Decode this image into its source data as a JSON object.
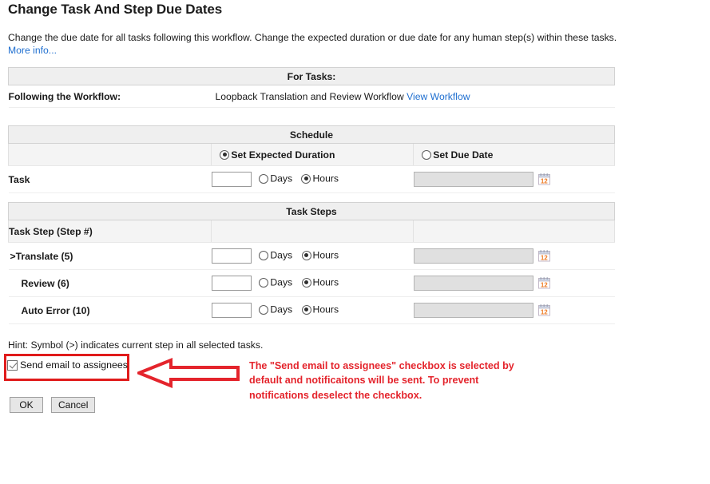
{
  "page": {
    "title": "Change Task And Step Due Dates",
    "description": "Change the due date for all tasks following this workflow. Change the expected duration or due date for any human step(s) within these tasks.",
    "more_info_label": "More info..."
  },
  "for_tasks": {
    "band_label": "For Tasks:",
    "workflow_row_label": "Following the Workflow:",
    "workflow_name": "Loopback Translation and Review Workflow",
    "view_workflow_link": "View Workflow"
  },
  "schedule": {
    "band_label": "Schedule",
    "mode_options": [
      {
        "label": "Set Expected Duration",
        "selected": true
      },
      {
        "label": "Set Due Date",
        "selected": false
      }
    ],
    "task_row": {
      "label": "Task",
      "duration_value": "",
      "unit_options": [
        {
          "label": "Days",
          "selected": false
        },
        {
          "label": "Hours",
          "selected": true
        }
      ],
      "due_date_value": "",
      "calendar_icon": "calendar-icon"
    }
  },
  "task_steps": {
    "band_label": "Task Steps",
    "column_header": "Task Step (Step #)",
    "rows": [
      {
        "label": ">Translate (5)",
        "duration_value": "",
        "unit_options": [
          {
            "label": "Days",
            "selected": false
          },
          {
            "label": "Hours",
            "selected": true
          }
        ],
        "due_date_value": "",
        "calendar_icon": "calendar-icon"
      },
      {
        "label": "Review (6)",
        "duration_value": "",
        "unit_options": [
          {
            "label": "Days",
            "selected": false
          },
          {
            "label": "Hours",
            "selected": true
          }
        ],
        "due_date_value": "",
        "calendar_icon": "calendar-icon"
      },
      {
        "label": "Auto Error (10)",
        "duration_value": "",
        "unit_options": [
          {
            "label": "Days",
            "selected": false
          },
          {
            "label": "Hours",
            "selected": true
          }
        ],
        "due_date_value": "",
        "calendar_icon": "calendar-icon"
      }
    ]
  },
  "hint": "Hint: Symbol (>) indicates current step in all selected tasks.",
  "notify": {
    "checkbox_label": "Send email to assignees",
    "checked": true
  },
  "annotation": {
    "text": "The \"Send email to assignees\" checkbox is selected by default and notificaitons will be sent. To prevent notifications deselect the checkbox.",
    "color": "#e4242c",
    "arrow_icon": "left-arrow-icon"
  },
  "footer": {
    "ok_label": "OK",
    "cancel_label": "Cancel"
  },
  "colors": {
    "link": "#1f6fd0",
    "annotation_red": "#e4242c",
    "band_gray": "#efefef"
  }
}
